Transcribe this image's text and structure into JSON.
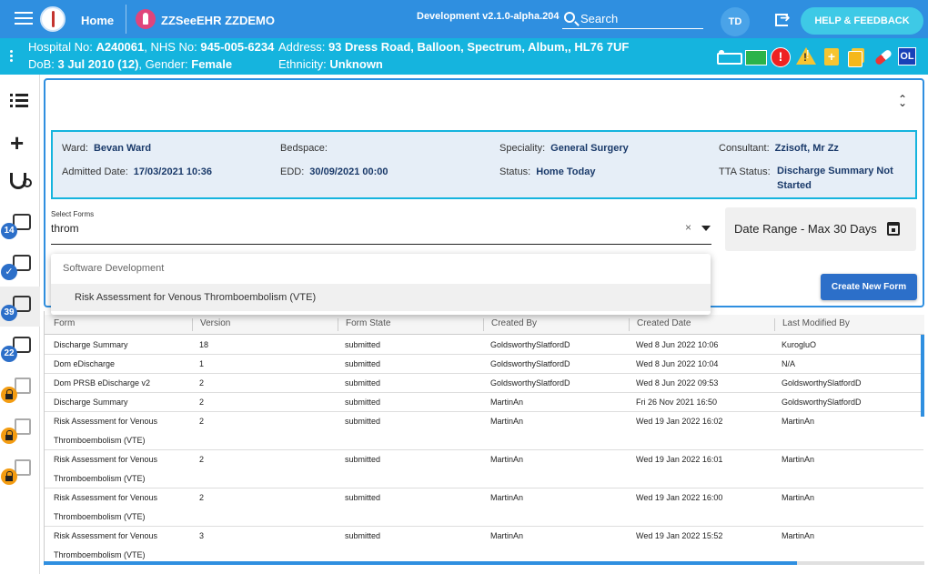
{
  "header": {
    "home_label": "Home",
    "patient_name": "ZZSeeEHR ZZDEMO",
    "environment": "Development v2.1.0-alpha.204",
    "search_placeholder": "Search",
    "user_initials": "TD",
    "help_label": "HELP & FEEDBACK"
  },
  "banner": {
    "hospital_label": "Hospital No:",
    "hospital_no": "A240061",
    "nhs_label": "NHS No:",
    "nhs_no": "945-005-6234",
    "dob_label": "DoB:",
    "dob": "3 Jul 2010 (12)",
    "gender_label": "Gender:",
    "gender": "Female",
    "address_label": "Address:",
    "address": "93 Dress Road, Balloon, Spectrum, Album,, HL76 7UF",
    "ethnicity_label": "Ethnicity:",
    "ethnicity": "Unknown",
    "ol_label": "OL"
  },
  "sidebar": {
    "badges": [
      "14",
      "39",
      "22"
    ]
  },
  "admission": {
    "ward_label": "Ward:",
    "ward": "Bevan Ward",
    "bedspace_label": "Bedspace:",
    "bedspace": "",
    "speciality_label": "Speciality:",
    "speciality": "General Surgery",
    "consultant_label": "Consultant:",
    "consultant": "Zzisoft, Mr Zz",
    "admitted_label": "Admitted Date:",
    "admitted": "17/03/2021 10:36",
    "edd_label": "EDD:",
    "edd": "30/09/2021 00:00",
    "status_label": "Status:",
    "status": "Home Today",
    "tta_label": "TTA Status:",
    "tta_line1": "Discharge Summary Not",
    "tta_line2": "Started"
  },
  "form_select": {
    "label": "Select Forms",
    "value": "throm",
    "clear": "×",
    "date_range": "Date Range - Max 30 Days",
    "create_label": "Create New Form"
  },
  "dropdown": {
    "group": "Software Development",
    "option": "Risk Assessment for Venous Thromboembolism (VTE)"
  },
  "table": {
    "headers": [
      "Form",
      "Version",
      "Form State",
      "Created By",
      "Created Date",
      "Last Modified By"
    ],
    "rows": [
      {
        "form": "Discharge Summary",
        "version": "18",
        "state": "submitted",
        "created_by": "GoldsworthySlatfordD",
        "created_date": "Wed 8 Jun 2022 10:06",
        "modified_by": "KurogluO"
      },
      {
        "form": "Dom eDischarge",
        "version": "1",
        "state": "submitted",
        "created_by": "GoldsworthySlatfordD",
        "created_date": "Wed 8 Jun 2022 10:04",
        "modified_by": "N/A"
      },
      {
        "form": "Dom PRSB eDischarge v2",
        "version": "2",
        "state": "submitted",
        "created_by": "GoldsworthySlatfordD",
        "created_date": "Wed 8 Jun 2022 09:53",
        "modified_by": "GoldsworthySlatfordD"
      },
      {
        "form": "Discharge Summary",
        "version": "2",
        "state": "submitted",
        "created_by": "MartinAn",
        "created_date": "Fri 26 Nov 2021 16:50",
        "modified_by": "GoldsworthySlatfordD"
      },
      {
        "form": "Risk Assessment for Venous Thromboembolism (VTE)",
        "version": "2",
        "state": "submitted",
        "created_by": "MartinAn",
        "created_date": "Wed 19 Jan 2022 16:02",
        "modified_by": "MartinAn"
      },
      {
        "form": "Risk Assessment for Venous Thromboembolism (VTE)",
        "version": "2",
        "state": "submitted",
        "created_by": "MartinAn",
        "created_date": "Wed 19 Jan 2022 16:01",
        "modified_by": "MartinAn"
      },
      {
        "form": "Risk Assessment for Venous Thromboembolism (VTE)",
        "version": "2",
        "state": "submitted",
        "created_by": "MartinAn",
        "created_date": "Wed 19 Jan 2022 16:00",
        "modified_by": "MartinAn"
      },
      {
        "form": "Risk Assessment for Venous Thromboembolism (VTE)",
        "version": "3",
        "state": "submitted",
        "created_by": "MartinAn",
        "created_date": "Wed 19 Jan 2022 15:52",
        "modified_by": "MartinAn"
      }
    ]
  }
}
